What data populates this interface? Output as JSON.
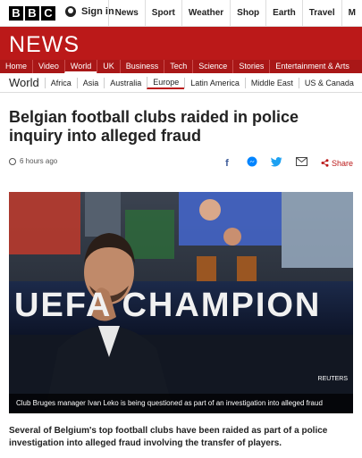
{
  "brand": {
    "letters": [
      "B",
      "B",
      "C"
    ],
    "news_logo": "NEWS",
    "accent_color": "#bb1919"
  },
  "topbar": {
    "signin_label": "Sign in",
    "nav": [
      "News",
      "Sport",
      "Weather",
      "Shop",
      "Earth",
      "Travel",
      "M"
    ]
  },
  "news_nav": {
    "items": [
      "Home",
      "Video",
      "World",
      "UK",
      "Business",
      "Tech",
      "Science",
      "Stories",
      "Entertainment & Arts"
    ],
    "active": "World"
  },
  "world_nav": {
    "section": "World",
    "items": [
      "Africa",
      "Asia",
      "Australia",
      "Europe",
      "Latin America",
      "Middle East",
      "US & Canada"
    ],
    "active": "Europe"
  },
  "article": {
    "headline": "Belgian football clubs raided in police inquiry into alleged fraud",
    "timestamp": "6 hours ago",
    "share_label": "Share",
    "share_icons": [
      "facebook-icon",
      "messenger-icon",
      "twitter-icon",
      "email-icon",
      "share-icon"
    ],
    "image": {
      "banner_text": "UEFA CHAMPION",
      "credit": "REUTERS",
      "caption": "Club Bruges manager Ivan Leko is being questioned as part of an investigation into alleged fraud"
    },
    "intro": "Several of Belgium's top football clubs have been raided as part of a police investigation into alleged fraud involving the transfer of players."
  }
}
